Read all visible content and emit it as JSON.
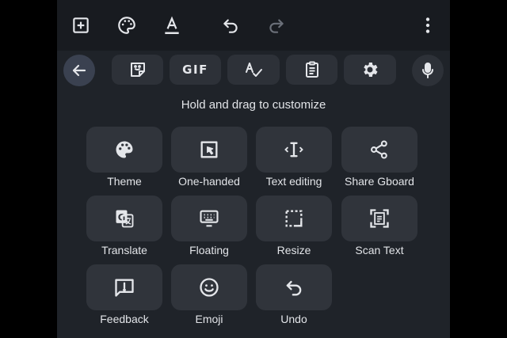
{
  "topbar": {
    "icons": [
      "add-box-icon",
      "palette-icon",
      "text-format-icon",
      "undo-icon",
      "redo-icon",
      "more-vert-icon"
    ]
  },
  "strip": {
    "gif_label": "GIF",
    "icons": [
      "arrow-back-icon",
      "sticker-icon",
      "gif-icon",
      "spellcheck-icon",
      "clipboard-icon",
      "gear-icon",
      "mic-icon"
    ]
  },
  "hint": "Hold and drag to customize",
  "tiles": [
    {
      "label": "Theme",
      "icon": "palette-icon"
    },
    {
      "label": "One-handed",
      "icon": "one-handed-icon"
    },
    {
      "label": "Text editing",
      "icon": "text-cursor-icon"
    },
    {
      "label": "Share Gboard",
      "icon": "share-icon"
    },
    {
      "label": "Translate",
      "icon": "translate-icon"
    },
    {
      "label": "Floating",
      "icon": "floating-keyboard-icon"
    },
    {
      "label": "Resize",
      "icon": "resize-icon"
    },
    {
      "label": "Scan Text",
      "icon": "scan-text-icon"
    },
    {
      "label": "Feedback",
      "icon": "feedback-icon"
    },
    {
      "label": "Emoji",
      "icon": "emoji-icon"
    },
    {
      "label": "Undo",
      "icon": "undo-icon"
    }
  ],
  "colors": {
    "keyboard_bg": "#1f2329",
    "topbar_bg": "#181b20",
    "tile_bg": "#30343b",
    "back_button_bg": "#3a4150",
    "icon": "#e4e6ea",
    "icon_disabled": "#6b7079"
  }
}
